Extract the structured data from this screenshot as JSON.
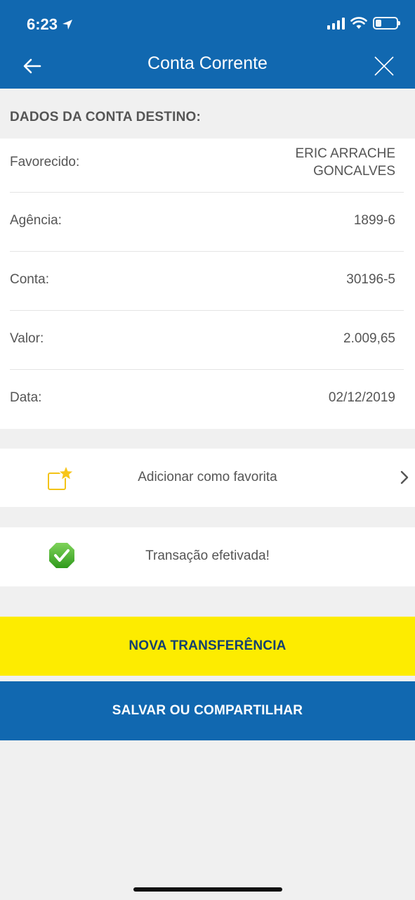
{
  "status_bar": {
    "time": "6:23"
  },
  "header": {
    "title": "Conta Corrente"
  },
  "section": {
    "title": "DADOS DA CONTA DESTINO:"
  },
  "details": {
    "favorecido_label": "Favorecido:",
    "favorecido_value_line1": "ERIC ARRACHE",
    "favorecido_value_line2": "GONCALVES",
    "agencia_label": "Agência:",
    "agencia_value": "1899-6",
    "conta_label": "Conta:",
    "conta_value": "30196-5",
    "valor_label": "Valor:",
    "valor_value": "2.009,65",
    "data_label": "Data:",
    "data_value": "02/12/2019"
  },
  "favorite": {
    "label": "Adicionar como favorita",
    "icon": "star-folder-icon"
  },
  "status": {
    "label": "Transação efetivada!",
    "icon": "check-icon"
  },
  "buttons": {
    "new_transfer": "NOVA TRANSFERÊNCIA",
    "save_share": "SALVAR OU COMPARTILHAR"
  },
  "colors": {
    "brand_blue": "#1168b0",
    "accent_yellow": "#fdec00",
    "success_green": "#4caf2a"
  }
}
